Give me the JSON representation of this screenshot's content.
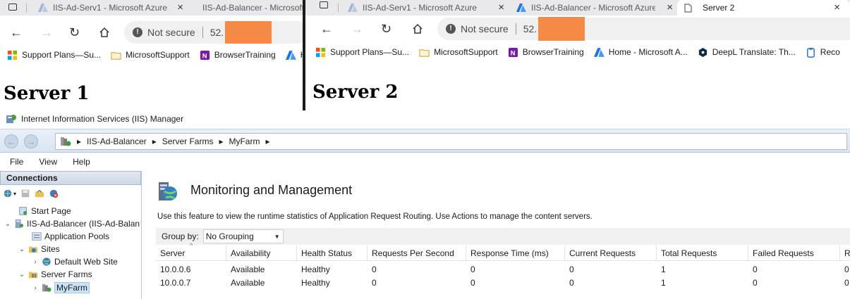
{
  "browser1": {
    "tabs": [
      {
        "label": "IIS-Ad-Serv1 - Microsoft Azure"
      },
      {
        "label": "IIS-Ad-Balancer - Microsoft Azure"
      }
    ],
    "security": "Not secure",
    "url": "52.",
    "favorites": [
      "Support Plans—Su...",
      "MicrosoftSupport",
      "BrowserTraining",
      "Ho"
    ],
    "heading": "Server 1"
  },
  "browser2": {
    "tabs": [
      {
        "label": "IIS-Ad-Serv1 - Microsoft Azure"
      },
      {
        "label": "IIS-Ad-Balancer - Microsoft Azure"
      },
      {
        "label": "Server 2"
      }
    ],
    "security": "Not secure",
    "url": "52.",
    "favorites": [
      "Support Plans—Su...",
      "MicrosoftSupport",
      "BrowserTraining",
      "Home - Microsoft A...",
      "DeepL Translate: Th...",
      "Reco"
    ],
    "heading": "Server 2"
  },
  "iis": {
    "app_title": "Internet Information Services (IIS) Manager",
    "breadcrumb": [
      "IIS-Ad-Balancer",
      "Server Farms",
      "MyFarm"
    ],
    "menu": [
      "File",
      "View",
      "Help"
    ],
    "connections_title": "Connections",
    "tree": {
      "start_page": "Start Page",
      "server": "IIS-Ad-Balancer (IIS-Ad-Balan",
      "app_pools": "Application Pools",
      "sites": "Sites",
      "default_site": "Default Web Site",
      "server_farms": "Server Farms",
      "farm": "MyFarm"
    },
    "feature_title": "Monitoring and Management",
    "feature_desc": "Use this feature to view the runtime statistics of Application Request Routing. Use Actions to manage the content servers.",
    "group_by_label": "Group by:",
    "group_by_value": "No Grouping",
    "columns": [
      "Server",
      "Availability",
      "Health Status",
      "Requests Per Second",
      "Response Time (ms)",
      "Current Requests",
      "Total Requests",
      "Failed Requests",
      "R"
    ],
    "rows": [
      [
        "10.0.0.6",
        "Available",
        "Healthy",
        "0",
        "0",
        "0",
        "1",
        "0",
        "0"
      ],
      [
        "10.0.0.7",
        "Available",
        "Healthy",
        "0",
        "0",
        "0",
        "1",
        "0",
        "0"
      ]
    ]
  },
  "colors": {
    "redaction": "#f58a47",
    "azure_blue": "#1a73e8"
  }
}
